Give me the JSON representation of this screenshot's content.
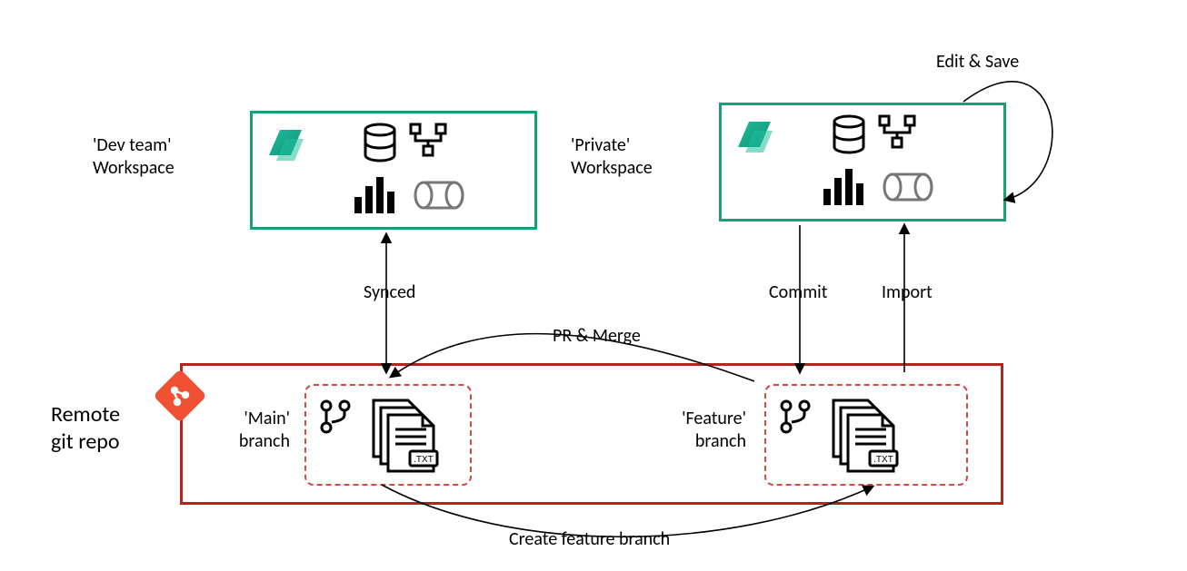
{
  "diagram": {
    "workspaces": {
      "dev": {
        "label_line1": "'Dev team'",
        "label_line2": "Workspace"
      },
      "private": {
        "label_line1": "'Private'",
        "label_line2": "Workspace"
      }
    },
    "repo": {
      "label_line1": "Remote",
      "label_line2": "git repo",
      "branches": {
        "main": {
          "label_line1": "'Main'",
          "label_line2": "branch"
        },
        "feature": {
          "label_line1": "'Feature'",
          "label_line2": "branch"
        }
      }
    },
    "arrows": {
      "synced": "Synced",
      "commit": "Commit",
      "import": "Import",
      "edit_save": "Edit & Save",
      "pr_merge": "PR & Merge",
      "create_feature_branch": "Create feature branch"
    },
    "icons": {
      "fabric": "fabric-icon",
      "database": "database-icon",
      "pipeline": "pipeline-icon",
      "barchart": "barchart-icon",
      "lakehouse": "lakehouse-icon",
      "git": "git-icon",
      "branch": "branch-icon",
      "files": "files-txt-icon"
    }
  }
}
